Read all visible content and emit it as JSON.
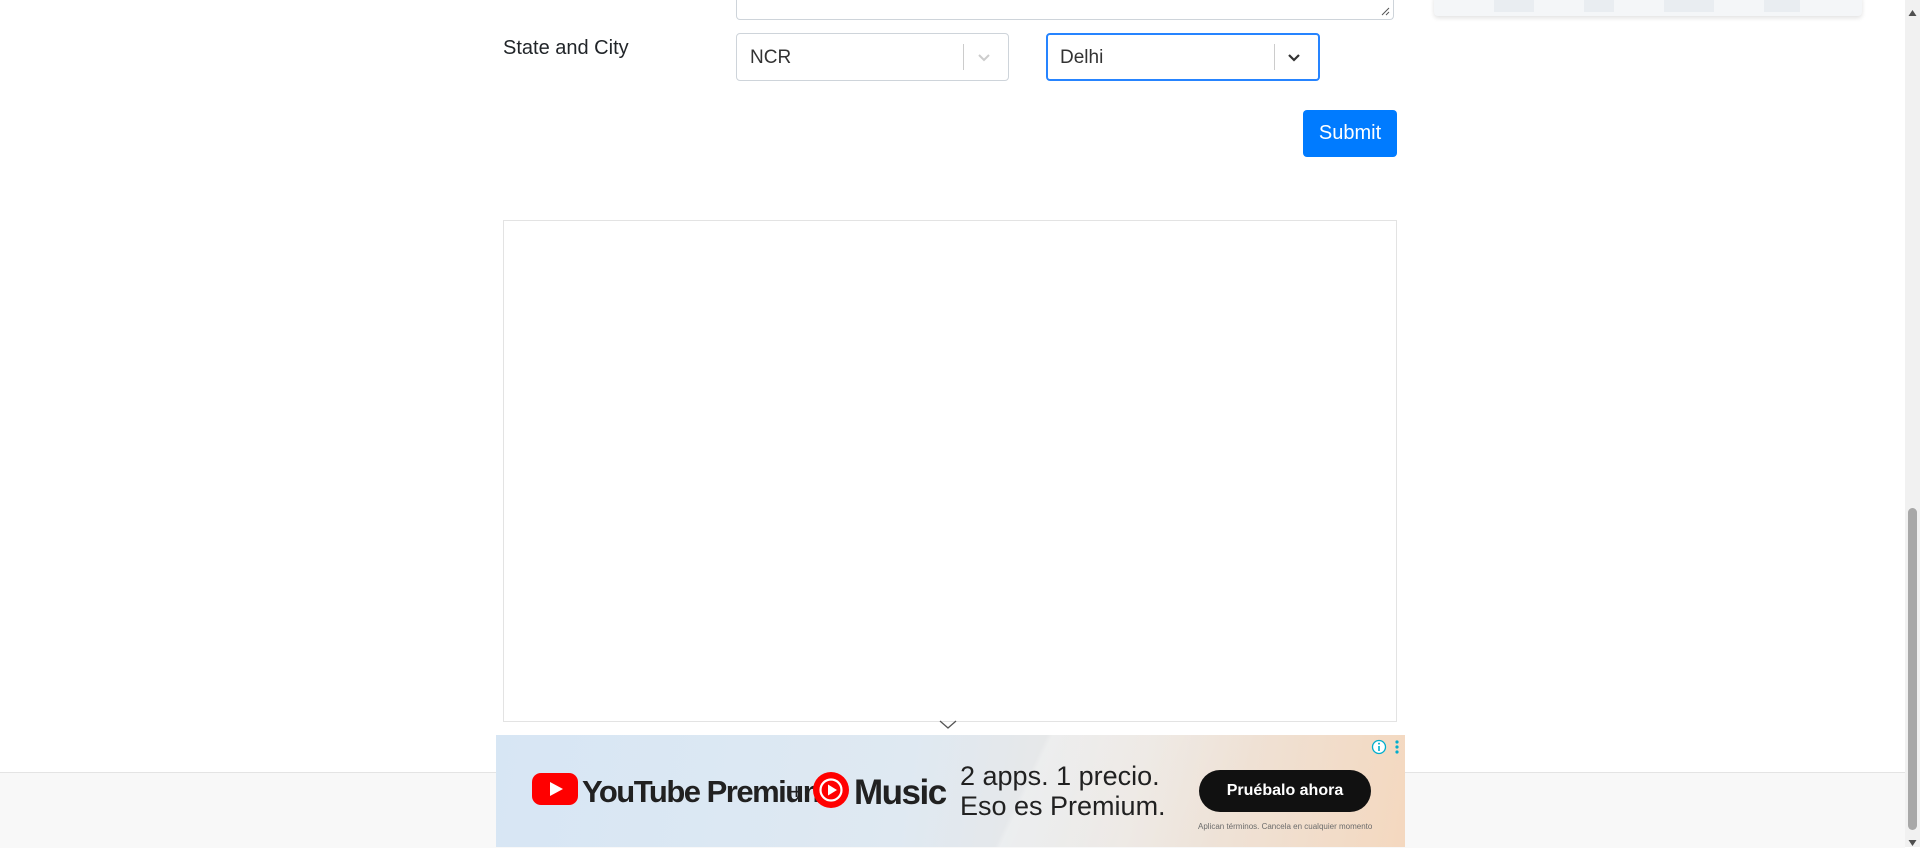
{
  "form": {
    "state_city_label": "State and City",
    "state_value": "NCR",
    "city_value": "Delhi",
    "submit_label": "Submit"
  },
  "ad": {
    "youtube_label": "YouTube Premium",
    "plus": "+",
    "music_label": "Music",
    "tagline_line1": "2 apps. 1 precio.",
    "tagline_line2": "Eso es Premium.",
    "cta_label": "Pruébalo ahora",
    "fineprint": "Aplican términos. Cancela en cualquier momento"
  },
  "colors": {
    "primary": "#007bff",
    "focus": "#2684ff",
    "youtube_red": "#ff0000",
    "cta_bg": "#111111"
  }
}
